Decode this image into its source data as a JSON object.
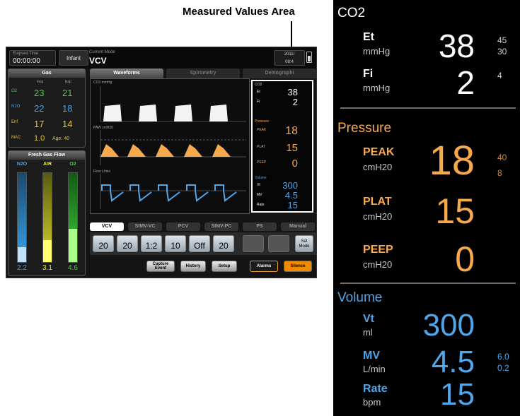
{
  "caption": "Measured Values Area",
  "colors": {
    "co2": "#ffffff",
    "pressure": "#f7a94c",
    "volume": "#4fa6ea",
    "o2": "#3fd13f",
    "air": "#e8e830",
    "n2o": "#3aa4f0"
  },
  "screen": {
    "elapsed_label": "Elapsed Time",
    "elapsed_value": "00:00:00",
    "patient": "Infant",
    "mode_label": "Current Mode",
    "mode_value": "VCV",
    "date": "2011/",
    "time": "08:4",
    "gas": {
      "title": "Gas",
      "col1": "Insp",
      "col2": "Exp",
      "rows": [
        {
          "name": "O2",
          "v1": "23",
          "v2": "21"
        },
        {
          "name": "N2O",
          "v1": "22",
          "v2": "18"
        },
        {
          "name": "Enf",
          "v1": "17",
          "v2": "14"
        },
        {
          "name": "MAC",
          "v1": "1.0",
          "v2": "Age: 40"
        }
      ]
    },
    "fgf": {
      "title": "Fresh Gas Flow",
      "tubes": [
        {
          "name": "N2O",
          "value": "2.2",
          "level": 0.17
        },
        {
          "name": "AIR",
          "value": "3.1",
          "level": 0.25
        },
        {
          "name": "O2",
          "value": "4.6",
          "level": 0.37
        }
      ]
    },
    "tabs": [
      "Waveforms",
      "Spirometry",
      "Demographi"
    ],
    "wave_labels": [
      "CO2 mmHg",
      "PAW cmH20",
      "Flow L/min"
    ],
    "mva_small": {
      "co2_title": "CO2",
      "pressure_title": "Pressure",
      "volume_title": "Volume",
      "et": "38",
      "fi": "2",
      "peak": "18",
      "plat": "15",
      "peep": "0",
      "vt": "300",
      "mv": "4.5",
      "rate": "15"
    },
    "mode_tabs": [
      "VCV",
      "SIMV-VC",
      "PCV",
      "SIMV-PC",
      "PS",
      "Manual"
    ],
    "settings": [
      "20",
      "20",
      "1:2",
      "10",
      "Off",
      "20"
    ],
    "set_mode": "Set Mode",
    "buttons": {
      "capture": "Capture Event",
      "history": "History",
      "setup": "Setup",
      "alarms": "Alarms",
      "silence": "Silence"
    }
  },
  "mva": {
    "co2": {
      "title": "CO2",
      "et": {
        "label": "Et",
        "unit": "mmHg",
        "value": "38",
        "limit_high": "45",
        "limit_low": "30"
      },
      "fi": {
        "label": "Fi",
        "unit": "mmHg",
        "value": "2",
        "limit_high": "4"
      }
    },
    "pressure": {
      "title": "Pressure",
      "peak": {
        "label": "PEAK",
        "unit": "cmH20",
        "value": "18",
        "limit_high": "40",
        "limit_low": "8"
      },
      "plat": {
        "label": "PLAT",
        "unit": "cmH20",
        "value": "15"
      },
      "peep": {
        "label": "PEEP",
        "unit": "cmH20",
        "value": "0"
      }
    },
    "volume": {
      "title": "Volume",
      "vt": {
        "label": "Vt",
        "unit": "ml",
        "value": "300"
      },
      "mv": {
        "label": "MV",
        "unit": "L/min",
        "value": "4.5",
        "limit_high": "6.0",
        "limit_low": "0.2"
      },
      "rate": {
        "label": "Rate",
        "unit": "bpm",
        "value": "15"
      }
    }
  }
}
